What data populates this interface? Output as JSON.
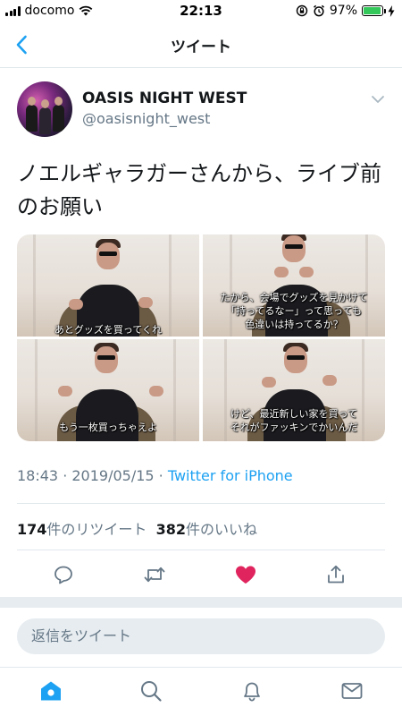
{
  "status_bar": {
    "carrier": "docomo",
    "time": "22:13",
    "battery_percent": "97%",
    "battery_level": 0.97,
    "icons": [
      "signal-icon",
      "wifi-icon",
      "rotation-lock-icon",
      "alarm-icon",
      "battery-icon",
      "charging-icon"
    ]
  },
  "nav": {
    "title": "ツイート",
    "back_icon": "chevron-left-icon"
  },
  "tweet": {
    "display_name": "OASIS NIGHT WEST",
    "handle": "@oasisnight_west",
    "text": "ノエルギャラガーさんから、ライブ前のお願い",
    "images": [
      {
        "caption": "あとグッズを買ってくれ"
      },
      {
        "caption": "たから、会場でグッズを見かけて\n「持ってるなー」って思っても\n色違いは持ってるか？"
      },
      {
        "caption": "もう一枚買っちゃえよ"
      },
      {
        "caption": "けど、最近新しい家を買って\nそれがファッキンでかいんだ"
      }
    ],
    "timestamp": "18:43 · 2019/05/15 · ",
    "source": "Twitter for iPhone",
    "retweet_count": "174",
    "retweet_label": "件のリツイート",
    "like_count": "382",
    "like_label": "件のいいね"
  },
  "actions": [
    "reply-icon",
    "retweet-icon",
    "like-icon",
    "share-icon"
  ],
  "reply": {
    "placeholder": "返信をツイート"
  },
  "tab_bar": [
    "home-icon",
    "search-icon",
    "notifications-icon",
    "messages-icon"
  ],
  "colors": {
    "accent": "#1da1f2",
    "like": "#e0245e",
    "secondary_text": "#657786",
    "divider": "#e1e8ed",
    "charging": "#34c759"
  }
}
